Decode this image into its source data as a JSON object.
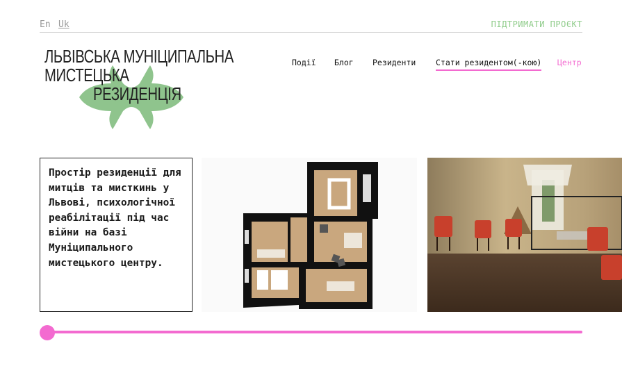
{
  "header": {
    "lang_en": "En",
    "lang_uk": "Uk",
    "support_link": "ПІДТРИМАТИ ПРОЄКТ"
  },
  "logo": {
    "line1": "ЛЬВІВСЬКА МУНІЦИПАЛЬНА",
    "line2": "МИСТЕЦЬКА",
    "line3": "РЕЗИДЕНЦІЯ"
  },
  "nav": {
    "items": [
      {
        "label": "Події"
      },
      {
        "label": "Блог"
      },
      {
        "label": "Резиденти"
      },
      {
        "label": "Стати резидентом(-кою)"
      },
      {
        "label": "Центр"
      }
    ]
  },
  "hero": {
    "description": "Простір резиденції для митців та мисткинь у Львові, психологічної реабілітації під час війни на базі Муніципального мистецького центру."
  },
  "slider": {
    "position": 0
  },
  "colors": {
    "accent_pink": "#f36ad0",
    "accent_green": "#8fc48d",
    "floor_wood": "#c9a77e"
  }
}
